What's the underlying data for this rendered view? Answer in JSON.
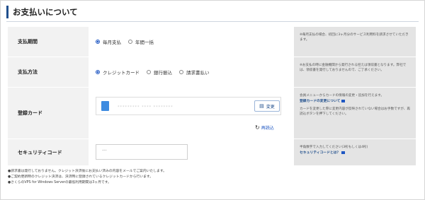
{
  "page": {
    "title": "お支払いについて"
  },
  "rows": {
    "period": {
      "label": "支払期間",
      "options": [
        "毎月支払",
        "年間一括"
      ],
      "selected": 0,
      "note": "※毎月支払の場合、初回に3ヶ月分のサービス利用料を請求させていただきます。"
    },
    "method": {
      "label": "支払方法",
      "options": [
        "クレジットカード",
        "銀行振込",
        "請求書払い"
      ],
      "selected": 0,
      "note": "※お支払の時に金融機関から発行される控えは領収書となります。弊社では、領収書を発行しておりませんので、ご了承ください。"
    },
    "card": {
      "label": "登録カード",
      "card_number": "********* **** ********",
      "change_label": "変更",
      "reload_label": "再読込",
      "note_line1": "会員メニューからカードの情報の変更・追加を行えます。",
      "note_link": "登録カードの変更について",
      "note_line2": "カードを変更した際に変更内容が反映されていない場合はお手数ですが、再読込ボタンを押下してください。"
    },
    "security": {
      "label": "セキュリティコード",
      "value": "***",
      "note_line1": "半角数字で入力してください(3桁もしくは4桁)",
      "note_link": "セキュリティコードとは？"
    }
  },
  "footer": [
    "●請求書は発行しておりません。クレジット決済後にお支払い済みの内容をメールでご案内いたします。",
    "●ご契約更新時のクレジット決済は、決済時に登録されているクレジットカードから行います。",
    "●さくらのVPS for Windows Serverの最低利用期間は3ヶ月です。"
  ],
  "colors": {
    "accent": "#1f4e8c",
    "radio": "#1f57c3",
    "panel": "#f2f2f2",
    "note_bg": "#e4e4e4"
  },
  "icons": {
    "card": "credit-card-icon",
    "edit": "edit-icon",
    "reload": "reload-icon",
    "link": "chat-icon"
  }
}
